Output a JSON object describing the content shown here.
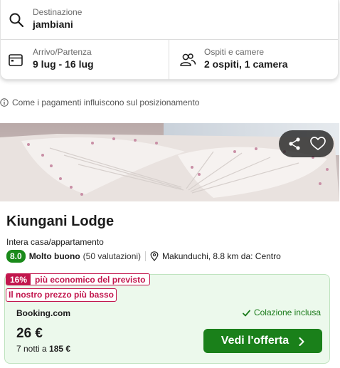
{
  "search": {
    "destination_label": "Destinazione",
    "destination_value": "jambiani",
    "dates_label": "Arrivo/Partenza",
    "dates_value": "9 lug - 16 lug",
    "guests_label": "Ospiti e camere",
    "guests_value": "2 ospiti, 1 camera"
  },
  "payment_info": "Come i pagamenti influiscono sul posizionamento",
  "hotel": {
    "name": "Kiungani Lodge",
    "type": "Intera casa/appartamento",
    "score": "8.0",
    "rating_label": "Molto buono",
    "reviews": "(50 valutazioni)",
    "location": "Makunduchi, 8.8 km da: Centro"
  },
  "deal": {
    "discount_pct": "16%",
    "discount_text": "più economico del previsto",
    "lowest_price": "Il nostro prezzo più basso",
    "provider": "Booking.com",
    "breakfast": "Colazione inclusa",
    "price": "26 €",
    "nights_prefix": "7 notti a",
    "total": "185 €",
    "cta": "Vedi l'offerta"
  },
  "icons": {
    "search": "search-icon",
    "calendar": "calendar-icon",
    "guests": "people-icon",
    "info": "info-icon",
    "share": "share-icon",
    "favorite": "heart-icon",
    "location": "map-pin-icon",
    "check": "check-icon",
    "chevron": "chevron-right-icon"
  },
  "colors": {
    "score_bg": "#1a8a1a",
    "badge_red": "#c2164d",
    "deal_bg": "#ecf9ec",
    "cta_bg": "#1a801a"
  }
}
